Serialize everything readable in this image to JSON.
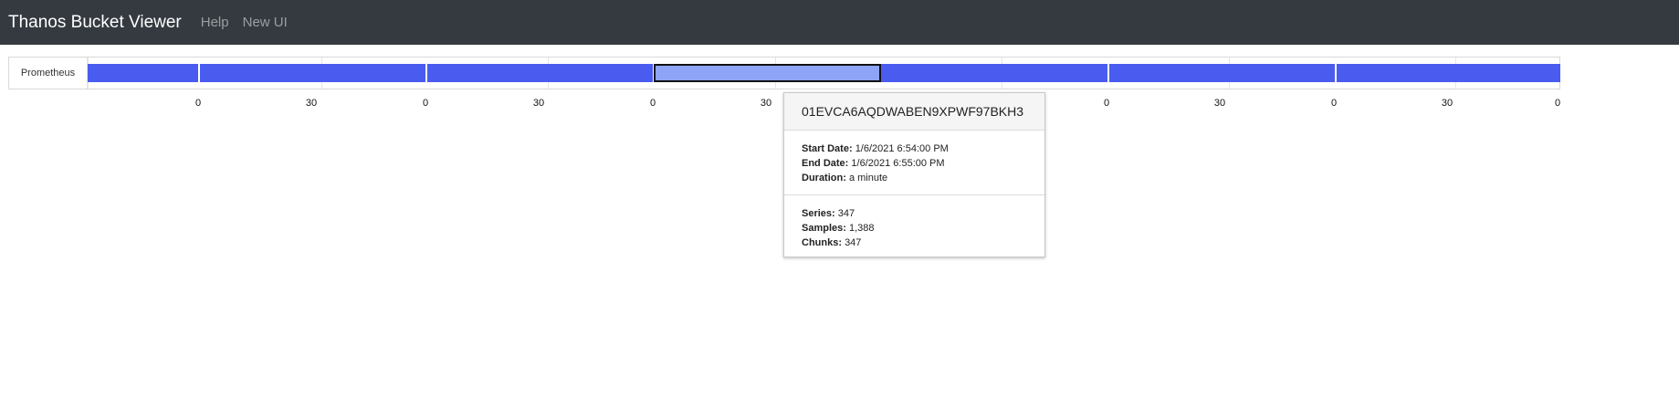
{
  "navbar": {
    "brand": "Thanos Bucket Viewer",
    "links": [
      "Help",
      "New UI"
    ]
  },
  "timeline": {
    "row_label": "Prometheus",
    "axis_ticks": [
      "0",
      "30",
      "0",
      "30",
      "0",
      "30",
      "0",
      "30",
      "0",
      "30",
      "0"
    ],
    "block_color": "#4a5cf0",
    "selected_block_color": "#8ea4f7"
  },
  "tooltip": {
    "title": "01EVCA6AQDWABEN9XPWF97BKH3",
    "start_label": "Start Date:",
    "start_value": "1/6/2021 6:54:00 PM",
    "end_label": "End Date:",
    "end_value": "1/6/2021 6:55:00 PM",
    "duration_label": "Duration:",
    "duration_value": "a minute",
    "series_label": "Series:",
    "series_value": "347",
    "samples_label": "Samples:",
    "samples_value": "1,388",
    "chunks_label": "Chunks:",
    "chunks_value": "347"
  },
  "colors": {
    "navbar_bg": "#343a40",
    "accent": "#4a5cf0"
  }
}
